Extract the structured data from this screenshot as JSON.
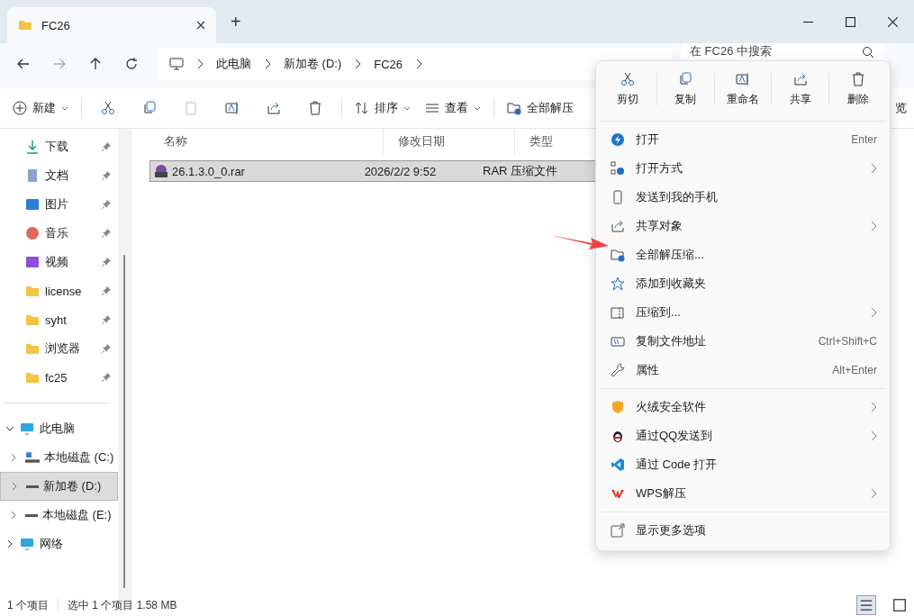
{
  "window": {
    "tab_title": "FC26",
    "new_tab": "+"
  },
  "address": {
    "crumbs": [
      "此电脑",
      "新加卷 (D:)",
      "FC26"
    ],
    "search": {
      "placeholder": "在 FC26 中搜索"
    }
  },
  "toolbar": {
    "new": "新建",
    "sort": "排序",
    "view": "查看",
    "extract": "全部解压",
    "preview": "览"
  },
  "columns": [
    "名称",
    "修改日期",
    "类型"
  ],
  "files": [
    {
      "name": "26.1.3.0_0.rar",
      "date": "2026/2/2 9:52",
      "type": "RAR 压缩文件",
      "selected": true
    }
  ],
  "quick_access": [
    {
      "label": "下载"
    },
    {
      "label": "文档"
    },
    {
      "label": "图片"
    },
    {
      "label": "音乐"
    },
    {
      "label": "视频"
    },
    {
      "label": "license"
    },
    {
      "label": "syht"
    },
    {
      "label": "浏览器"
    },
    {
      "label": "fc25"
    }
  ],
  "tree": [
    {
      "label": "此电脑",
      "expanded": true,
      "selected": false,
      "children": [
        {
          "label": "本地磁盘 (C:)",
          "expanded": false,
          "selected": false
        },
        {
          "label": "新加卷 (D:)",
          "expanded": false,
          "selected": true
        },
        {
          "label": "本地磁盘 (E:)",
          "expanded": false,
          "selected": false
        }
      ]
    },
    {
      "label": "网络",
      "expanded": false,
      "selected": false
    }
  ],
  "status_bar": {
    "count": "1 个项目",
    "selection": "选中 1 个项目  1.58 MB"
  },
  "context_menu": {
    "actions": [
      "剪切",
      "复制",
      "重命名",
      "共享",
      "删除"
    ],
    "groups": [
      [
        {
          "label": "打开",
          "shortcut": "Enter",
          "submenu": false
        },
        {
          "label": "打开方式",
          "submenu": true
        },
        {
          "label": "发送到我的手机",
          "submenu": false
        },
        {
          "label": "共享对象",
          "submenu": true
        },
        {
          "label": "全部解压缩...",
          "submenu": false
        },
        {
          "label": "添加到收藏夹",
          "submenu": false
        },
        {
          "label": "压缩到...",
          "submenu": true
        },
        {
          "label": "复制文件地址",
          "shortcut": "Ctrl+Shift+C",
          "submenu": false
        },
        {
          "label": "属性",
          "shortcut": "Alt+Enter",
          "submenu": false
        }
      ],
      [
        {
          "label": "火绒安全软件",
          "submenu": true
        },
        {
          "label": "通过QQ发送到",
          "submenu": true
        },
        {
          "label": "通过 Code 打开",
          "submenu": false
        },
        {
          "label": "WPS解压",
          "submenu": true
        }
      ],
      [
        {
          "label": "显示更多选项",
          "submenu": false
        }
      ]
    ]
  }
}
